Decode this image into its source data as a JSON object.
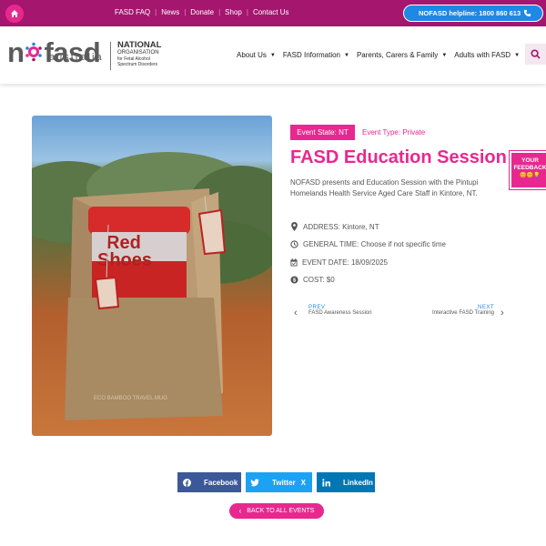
{
  "topbar": {
    "links": [
      "FASD FAQ",
      "News",
      "Donate",
      "Shop",
      "Contact Us"
    ],
    "helpline": "NOFASD helpline: 1800 860 613"
  },
  "logo": {
    "wordmark_a": "n",
    "wordmark_b": "fasd",
    "sub": "australia",
    "org_line1": "NATIONAL",
    "org_line2": "ORGANISATION",
    "org_line3": "for Fetal Alcohol",
    "org_line4": "Spectrum Disorders"
  },
  "nav": {
    "items": [
      "About Us",
      "FASD Information",
      "Parents, Carers & Family",
      "Adults with FASD"
    ]
  },
  "photo": {
    "cup_text_line1": "Red",
    "cup_text_line2": "Shoes",
    "box_text": "ECO BAMBOO TRAVEL MUG"
  },
  "event": {
    "state_label": "Event State: NT",
    "type_label": "Event Type: Private",
    "title": "FASD Education Session",
    "description": "NOFASD presents and Education Session with the Pintupi Homelands Health Service Aged Care Staff in Kintore, NT.",
    "address": "ADDRESS: Kintore, NT",
    "time": "GENERAL TIME: Choose if not specific time",
    "date": "EVENT DATE: 18/09/2025",
    "cost": "COST: $0"
  },
  "pager": {
    "prev_label": "PREV",
    "prev_title": "FASD Awareness Session",
    "next_label": "NEXT",
    "next_title": "Interactive FASD Training"
  },
  "feedback": {
    "line1": "YOUR",
    "line2": "FEEDBACK",
    "emojis": "😊😐💡"
  },
  "share": {
    "facebook": "Facebook",
    "twitter": "Twitter",
    "twitter_x": "X",
    "linkedin": "LinkedIn"
  },
  "back_button": "BACK TO ALL EVENTS",
  "colors": {
    "topbar": "#a5166e",
    "brand_pink": "#e8288f",
    "helpline_blue": "#1e88e5",
    "facebook": "#3b5998",
    "twitter": "#1da1f2",
    "linkedin": "#0077b5"
  },
  "icons": {
    "home": "home-icon",
    "phone": "phone-icon",
    "search": "search-icon",
    "address": "map-pin-icon",
    "time": "clock-icon",
    "date": "calendar-icon",
    "cost": "money-icon"
  }
}
